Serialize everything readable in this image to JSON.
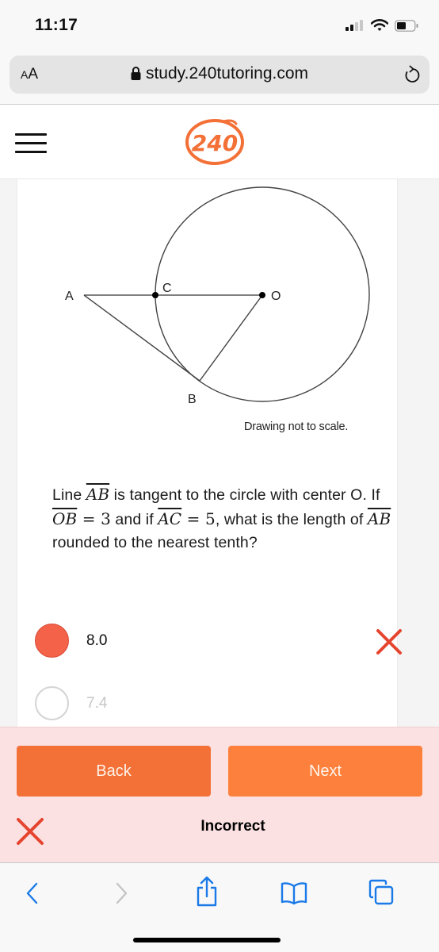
{
  "status_bar": {
    "time": "11:17",
    "signal_bars_active": 2,
    "signal_bars_total": 4,
    "battery_level": 0.4
  },
  "browser": {
    "text_size_label_small": "A",
    "text_size_label_large": "A",
    "url": "study.240tutoring.com",
    "secure": true
  },
  "site": {
    "logo_text": "240",
    "brand_color": "#f37037"
  },
  "question": {
    "diagram": {
      "points": [
        "A",
        "C",
        "O",
        "B"
      ],
      "note": "Drawing not to scale."
    },
    "text_parts": {
      "p1": "Line ",
      "ab": "AB",
      "p2": " is tangent to the circle with center O. If ",
      "ob": "OB",
      "eq1": " = 3",
      "p3": " and if ",
      "ac": "AC",
      "eq2": " = 5",
      "p4": ", what is the length of ",
      "ab2": "AB",
      "p5": " rounded to the nearest tenth?"
    },
    "options": [
      {
        "label": "8.0",
        "selected": true,
        "marked_wrong": true
      },
      {
        "label": "7.4",
        "selected": false,
        "marked_wrong": false
      }
    ]
  },
  "feedback": {
    "back_label": "Back",
    "next_label": "Next",
    "result_text": "Incorrect",
    "background": "#fbe1e2",
    "error_color": "#e5452f"
  },
  "toolbar": {
    "icons": [
      "back-icon",
      "forward-icon",
      "share-icon",
      "bookmarks-icon",
      "tabs-icon"
    ],
    "accent": "#1a7ae8"
  }
}
